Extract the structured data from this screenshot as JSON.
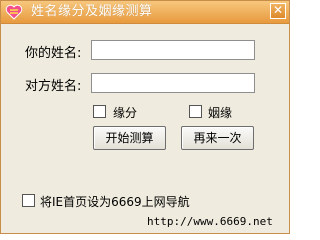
{
  "window": {
    "title": "姓名缘分及姻缘测算",
    "close_glyph": "✕"
  },
  "form": {
    "your_name_label": "你的姓名:",
    "your_name_value": "",
    "partner_name_label": "对方姓名:",
    "partner_name_value": ""
  },
  "options": {
    "fate_label": "缘分",
    "marriage_label": "姻缘"
  },
  "buttons": {
    "start_label": "开始测算",
    "again_label": "再来一次"
  },
  "footer": {
    "homepage_label": "将IE首页设为6669上网导航",
    "url": "http://www.6669.net"
  },
  "colors": {
    "titlebar": "#e89a3e",
    "window_bg": "#efebde"
  }
}
